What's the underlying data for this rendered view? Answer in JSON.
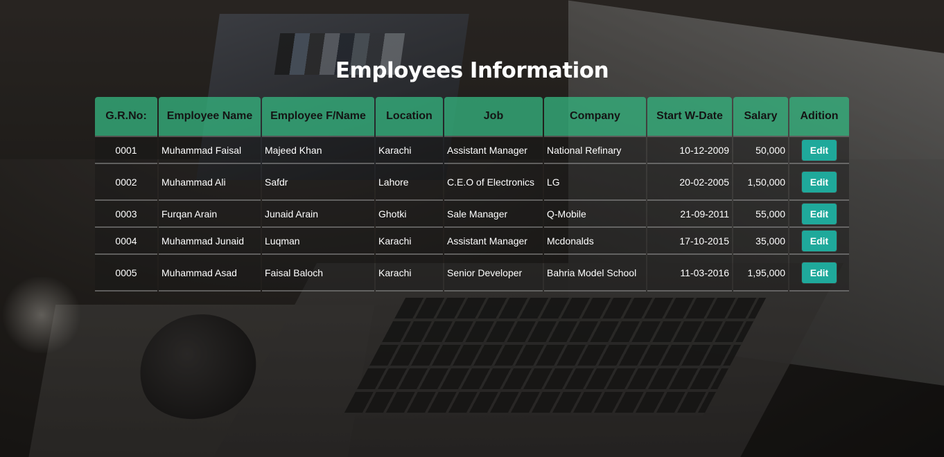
{
  "page": {
    "title": "Employees Information"
  },
  "table": {
    "columns": [
      {
        "key": "grno",
        "label": "G.R.No:"
      },
      {
        "key": "name",
        "label": "Employee Name"
      },
      {
        "key": "fname",
        "label": "Employee F/Name"
      },
      {
        "key": "location",
        "label": "Location"
      },
      {
        "key": "job",
        "label": "Job"
      },
      {
        "key": "company",
        "label": "Company"
      },
      {
        "key": "start_date",
        "label": "Start W-Date"
      },
      {
        "key": "salary",
        "label": "Salary"
      },
      {
        "key": "addition",
        "label": "Adition"
      }
    ],
    "rows": [
      {
        "grno": "0001",
        "name": "Muhammad Faisal",
        "fname": "Majeed Khan",
        "location": "Karachi",
        "job": "Assistant Manager",
        "company": "National Refinary",
        "start_date": "10-12-2009",
        "salary": "50,000",
        "action": "Edit"
      },
      {
        "grno": "0002",
        "name": "Muhammad Ali",
        "fname": "Safdr",
        "location": "Lahore",
        "job": "C.E.O of Electronics",
        "company": "LG",
        "start_date": "20-02-2005",
        "salary": "1,50,000",
        "action": "Edit"
      },
      {
        "grno": "0003",
        "name": "Furqan Arain",
        "fname": "Junaid Arain",
        "location": "Ghotki",
        "job": "Sale Manager",
        "company": "Q-Mobile",
        "start_date": "21-09-2011",
        "salary": "55,000",
        "action": "Edit"
      },
      {
        "grno": "0004",
        "name": "Muhammad Junaid",
        "fname": "Luqman",
        "location": "Karachi",
        "job": "Assistant Manager",
        "company": "Mcdonalds",
        "start_date": "17-10-2015",
        "salary": "35,000",
        "action": "Edit"
      },
      {
        "grno": "0005",
        "name": "Muhammad Asad",
        "fname": "Faisal Baloch",
        "location": "Karachi",
        "job": "Senior Developer",
        "company": "Bahria Model School",
        "start_date": "11-03-2016",
        "salary": "1,95,000",
        "action": "Edit"
      }
    ]
  },
  "colors": {
    "header_bg": "#34b27e",
    "edit_button": "#1fa99b",
    "text": "#ffffff"
  }
}
